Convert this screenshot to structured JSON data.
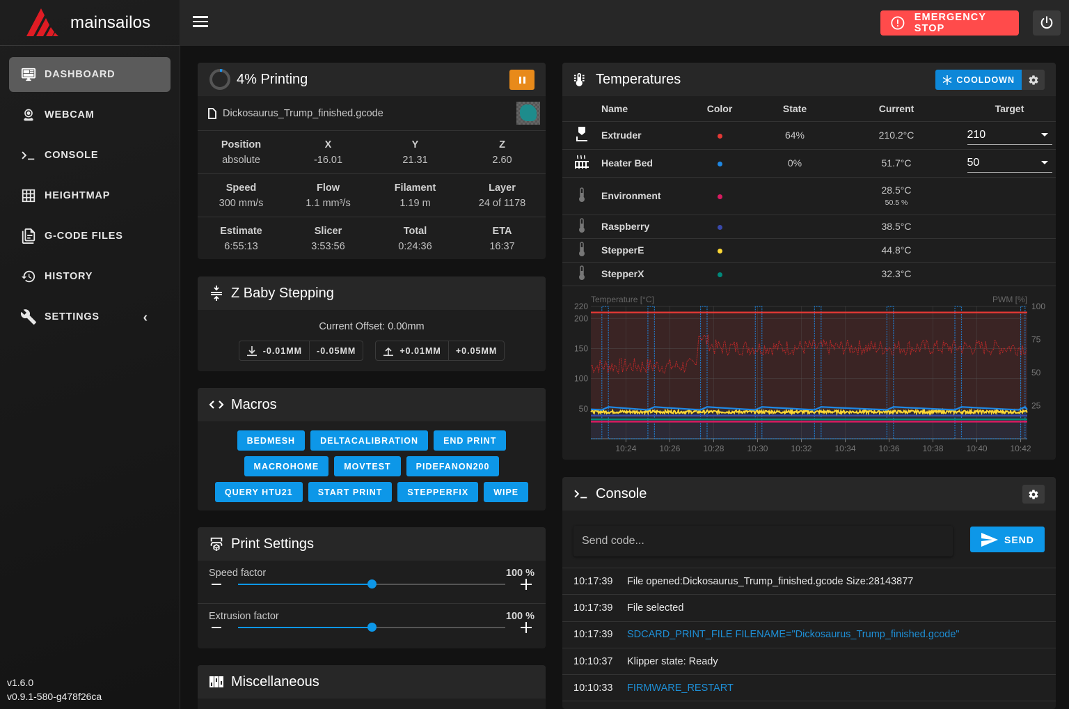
{
  "app": {
    "title": "mainsailos"
  },
  "sidebar": {
    "items": [
      {
        "label": "DASHBOARD",
        "icon": "monitor-dashboard-icon",
        "active": true
      },
      {
        "label": "WEBCAM",
        "icon": "webcam-icon"
      },
      {
        "label": "CONSOLE",
        "icon": "console-icon"
      },
      {
        "label": "HEIGHTMAP",
        "icon": "grid-icon"
      },
      {
        "label": "G-CODE FILES",
        "icon": "file-document-multiple-icon"
      },
      {
        "label": "HISTORY",
        "icon": "history-icon"
      },
      {
        "label": "SETTINGS",
        "icon": "wrench-icon"
      }
    ],
    "version_client": "v1.6.0",
    "version_klipper": "v0.9.1-580-g478f26ca"
  },
  "topbar": {
    "emergency_stop_label": "EMERGENCY STOP"
  },
  "status": {
    "progress_percent": 4,
    "title": "4% Printing",
    "filename": "Dickosaurus_Trump_finished.gcode",
    "rows": [
      [
        {
          "label": "Position",
          "value": "absolute"
        },
        {
          "label": "X",
          "value": "-16.01"
        },
        {
          "label": "Y",
          "value": "21.31"
        },
        {
          "label": "Z",
          "value": "2.60"
        }
      ],
      [
        {
          "label": "Speed",
          "value": "300 mm/s"
        },
        {
          "label": "Flow",
          "value": "1.1 mm³/s"
        },
        {
          "label": "Filament",
          "value": "1.19 m"
        },
        {
          "label": "Layer",
          "value": "24 of 1178"
        }
      ],
      [
        {
          "label": "Estimate",
          "value": "6:55:13"
        },
        {
          "label": "Slicer",
          "value": "3:53:56"
        },
        {
          "label": "Total",
          "value": "0:24:36"
        },
        {
          "label": "ETA",
          "value": "16:37"
        }
      ]
    ]
  },
  "zbaby": {
    "title": "Z Baby Stepping",
    "offset_text": "Current Offset: 0.00mm",
    "down_buttons": [
      "-0.01MM",
      "-0.05MM"
    ],
    "up_buttons": [
      "+0.01MM",
      "+0.05MM"
    ]
  },
  "macros": {
    "title": "Macros",
    "rows": [
      [
        "BEDMESH",
        "DELTACALIBRATION",
        "END PRINT"
      ],
      [
        "MACROHOME",
        "MOVTEST",
        "PIDEFANON200"
      ],
      [
        "QUERY HTU21",
        "START PRINT",
        "STEPPERFIX",
        "WIPE"
      ]
    ]
  },
  "print_settings": {
    "title": "Print Settings",
    "sliders": [
      {
        "label": "Speed factor",
        "value_text": "100 %",
        "fraction": 0.5
      },
      {
        "label": "Extrusion factor",
        "value_text": "100 %",
        "fraction": 0.5
      }
    ]
  },
  "misc": {
    "title": "Miscellaneous"
  },
  "temperatures": {
    "title": "Temperatures",
    "cooldown_label": "COOLDOWN",
    "columns": [
      "Name",
      "Color",
      "State",
      "Current",
      "Target"
    ],
    "rows": [
      {
        "name": "Extruder",
        "icon": "extruder-icon",
        "color": "#e53935",
        "state": "64%",
        "current": "210.2°C",
        "target": "210"
      },
      {
        "name": "Heater Bed",
        "icon": "radiator-icon",
        "color": "#1e88e5",
        "state": "0%",
        "current": "51.7°C",
        "target": "50"
      },
      {
        "name": "Environment",
        "icon": "thermometer-icon",
        "color": "#d81b60",
        "state": "",
        "current": "28.5°C",
        "sub": "50.5 %"
      },
      {
        "name": "Raspberry",
        "icon": "thermometer-icon",
        "color": "#3949ab",
        "state": "",
        "current": "38.5°C"
      },
      {
        "name": "StepperE",
        "icon": "thermometer-icon",
        "color": "#fdd835",
        "state": "",
        "current": "44.8°C"
      },
      {
        "name": "StepperX",
        "icon": "thermometer-icon",
        "color": "#00897b",
        "state": "",
        "current": "32.3°C"
      }
    ]
  },
  "chart_data": {
    "type": "line",
    "title": "",
    "ylabel": "Temperature [°C]",
    "y2label": "PWM [%]",
    "ylim": [
      0,
      220
    ],
    "y2lim": [
      0,
      100
    ],
    "yticks": [
      50,
      100,
      150,
      200,
      220
    ],
    "y2ticks": [
      25,
      50,
      75,
      100
    ],
    "xticks": [
      "10:24",
      "10:26",
      "10:28",
      "10:30",
      "10:32",
      "10:34",
      "10:36",
      "10:38",
      "10:40",
      "10:42"
    ],
    "xrange_minutes": [
      22.4,
      42.3
    ],
    "grid": true,
    "series": [
      {
        "name": "Extruder",
        "color": "#e53935",
        "kind": "temp",
        "level": 210
      },
      {
        "name": "Extruder target",
        "color": "#e53935",
        "kind": "target-fill",
        "level": 210
      },
      {
        "name": "Extruder PWM",
        "color": "#c62828",
        "kind": "pwm",
        "levels": [
          [
            22.4,
            55
          ],
          [
            27.2,
            55
          ],
          [
            27.3,
            80
          ],
          [
            28,
            69
          ],
          [
            42.3,
            69
          ]
        ]
      },
      {
        "name": "Heater Bed",
        "color": "#1e88e5",
        "kind": "temp-sawtooth",
        "low": 48,
        "high": 53,
        "peaks": [
          23.2,
          25.3,
          27.7,
          30.2,
          32.9,
          36.2,
          39.3,
          42.2
        ]
      },
      {
        "name": "Heater Bed PWM",
        "color": "#1e88e5",
        "kind": "pulses",
        "pulses": [
          [
            22.9,
            23.2
          ],
          [
            25.0,
            25.3
          ],
          [
            27.4,
            27.7
          ],
          [
            29.9,
            30.2
          ],
          [
            32.6,
            32.9
          ],
          [
            35.9,
            36.2
          ],
          [
            39.0,
            39.3
          ],
          [
            42.0,
            42.2
          ]
        ]
      },
      {
        "name": "StepperE",
        "color": "#fdd835",
        "kind": "noisy",
        "level": 44.8
      },
      {
        "name": "Raspberry",
        "color": "#3949ab",
        "kind": "flat",
        "level": 38.5
      },
      {
        "name": "StepperX",
        "color": "#00897b",
        "kind": "flat",
        "level": 32.3
      },
      {
        "name": "Environment",
        "color": "#d81b60",
        "kind": "flat",
        "level": 28.5
      }
    ]
  },
  "console": {
    "title": "Console",
    "input_placeholder": "Send code...",
    "send_label": "SEND",
    "entries": [
      {
        "time": "10:17:39",
        "message": "File opened:Dickosaurus_Trump_finished.gcode Size:28143877",
        "type": "response"
      },
      {
        "time": "10:17:39",
        "message": "File selected",
        "type": "response"
      },
      {
        "time": "10:17:39",
        "message": "SDCARD_PRINT_FILE FILENAME=\"Dickosaurus_Trump_finished.gcode\"",
        "type": "command"
      },
      {
        "time": "10:10:37",
        "message": "Klipper state: Ready",
        "type": "response"
      },
      {
        "time": "10:10:33",
        "message": "FIRMWARE_RESTART",
        "type": "command"
      }
    ]
  }
}
